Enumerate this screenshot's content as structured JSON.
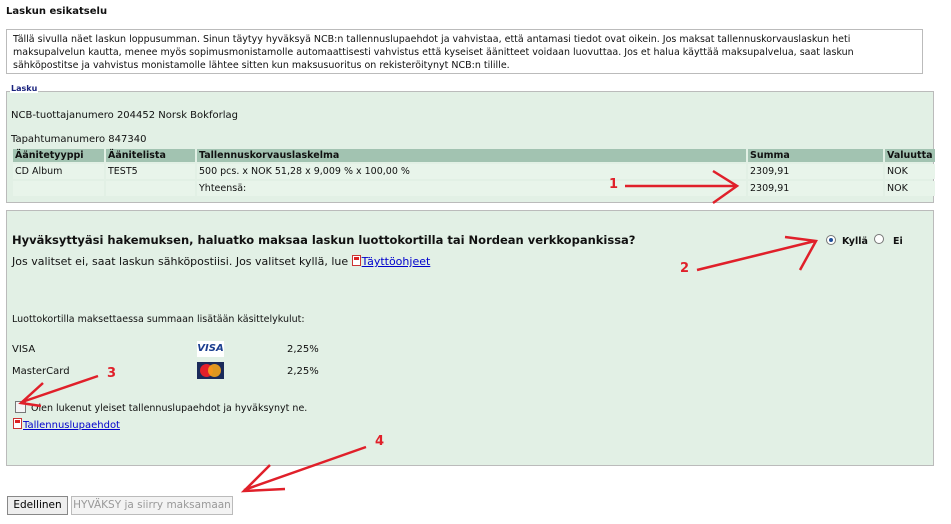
{
  "page": {
    "title": "Laskun esikatselu",
    "info": "Tällä sivulla näet laskun loppusumman. Sinun täytyy hyväksyä NCB:n tallennuslupaehdot ja vahvistaa, että antamasi tiedot ovat oikein. Jos maksat tallennuskorvauslaskun heti maksupalvelun kautta, menee myös sopimusmonistamolle automaattisesti vahvistus että kyseiset äänitteet voidaan luovuttaa. Jos et halua käyttää maksupalvelua, saat laskun sähköpostitse ja vahvistus monistamolle lähtee sitten kun maksusuoritus on rekisteröitynyt NCB:n tilille."
  },
  "invoice": {
    "legend": "Lasku",
    "producer": "NCB-tuottajanumero 204452  Norsk Bokforlag",
    "transaction": "Tapahtumanumero  847340",
    "headers": [
      "Äänitetyyppi",
      "Äänitelista",
      "Tallennuskorvauslaskelma",
      "Summa",
      "Valuutta"
    ],
    "rows": [
      [
        "CD Album",
        "TEST5",
        "500 pcs. x NOK 51,28 x 9,009 % x 100,00 %",
        "2309,91",
        "NOK"
      ],
      [
        "",
        "",
        "Yhteensä:",
        "2309,91",
        "NOK"
      ]
    ]
  },
  "payment": {
    "question": "Hyväksyttyäsi hakemuksen, haluatko maksaa laskun luottokortilla tai Nordean verkkopankissa?",
    "yes": "Kyllä",
    "no": "Ei",
    "selected": "Kyllä",
    "note": "Jos valitset ei, saat laskun sähköpostiisi. Jos valitset kyllä, lue",
    "guide_link": "Täyttöohjeet",
    "fees_label": "Luottokortilla maksettaessa summaan lisätään käsittelykulut:",
    "cards": [
      {
        "name": "VISA",
        "logo": "VISA",
        "fee": "2,25%"
      },
      {
        "name": "MasterCard",
        "logo": "MasterCard",
        "fee": "2,25%"
      }
    ],
    "accept_label": "Olen lukenut yleiset tallennuslupaehdot ja hyväksynyt ne.",
    "accept_checked": false,
    "terms_link": "Tallennuslupaehdot"
  },
  "buttons": {
    "back": "Edellinen",
    "accept": "HYVÄKSY ja siirry maksamaan"
  },
  "annotations": {
    "color": "#e0202a",
    "labels": [
      "1",
      "2",
      "3",
      "4"
    ]
  }
}
